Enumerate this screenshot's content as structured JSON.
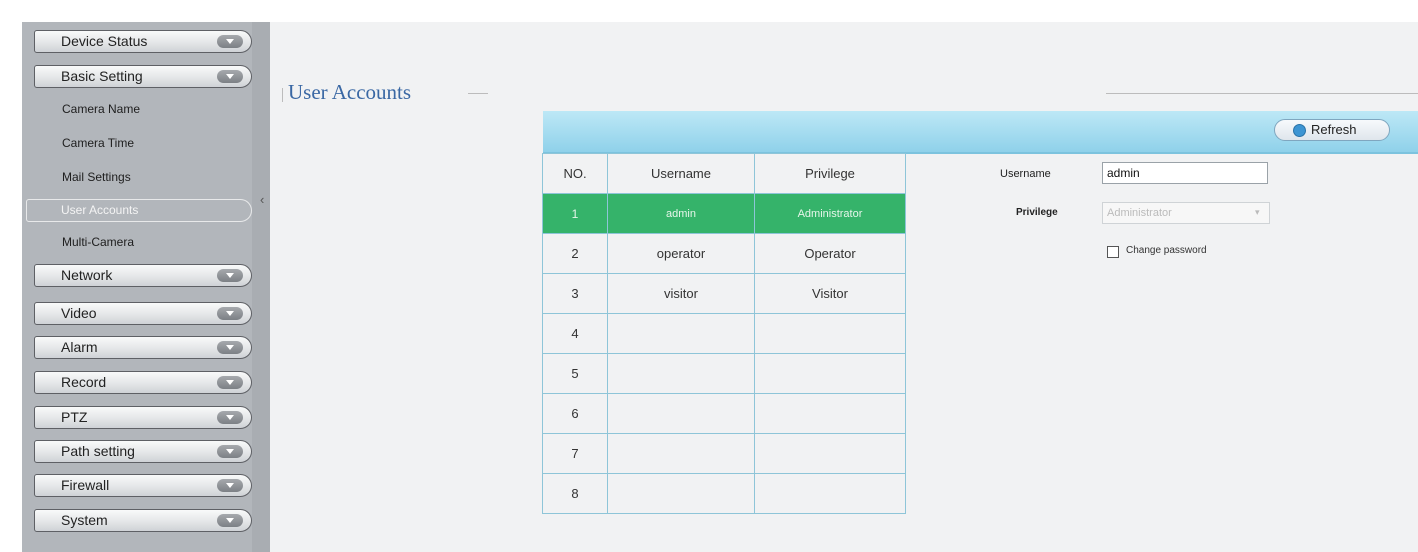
{
  "sidebar": {
    "menus": [
      {
        "label": "Device Status"
      },
      {
        "label": "Basic Setting"
      },
      {
        "label": "Network"
      },
      {
        "label": "Video"
      },
      {
        "label": "Alarm"
      },
      {
        "label": "Record"
      },
      {
        "label": "PTZ"
      },
      {
        "label": "Path setting"
      },
      {
        "label": "Firewall"
      },
      {
        "label": "System"
      }
    ],
    "submenu": [
      {
        "label": "Camera Name"
      },
      {
        "label": "Camera Time"
      },
      {
        "label": "Mail Settings"
      },
      {
        "label": "User Accounts"
      },
      {
        "label": "Multi-Camera"
      }
    ],
    "active_submenu": "User Accounts"
  },
  "main": {
    "title": "User Accounts",
    "refresh_label": "Refresh",
    "table": {
      "headers": [
        "NO.",
        "Username",
        "Privilege"
      ],
      "rows": [
        {
          "no": "1",
          "username": "admin",
          "privilege": "Administrator"
        },
        {
          "no": "2",
          "username": "operator",
          "privilege": "Operator"
        },
        {
          "no": "3",
          "username": "visitor",
          "privilege": "Visitor"
        },
        {
          "no": "4",
          "username": "",
          "privilege": ""
        },
        {
          "no": "5",
          "username": "",
          "privilege": ""
        },
        {
          "no": "6",
          "username": "",
          "privilege": ""
        },
        {
          "no": "7",
          "username": "",
          "privilege": ""
        },
        {
          "no": "8",
          "username": "",
          "privilege": ""
        }
      ]
    },
    "form": {
      "username_label": "Username",
      "username_value": "admin",
      "privilege_label": "Privilege",
      "privilege_value": "Administrator",
      "change_password_label": "Change password"
    }
  },
  "colors": {
    "selected_row": "#35b36a",
    "title": "#3a68a4",
    "header_bar": "#a8def1"
  },
  "icons": {
    "menu_chevron": "chevron-down-icon",
    "refresh": "refresh-icon",
    "select_arrow": "dropdown-arrow-icon",
    "sidebar_collapse": "collapse-caret-icon"
  }
}
